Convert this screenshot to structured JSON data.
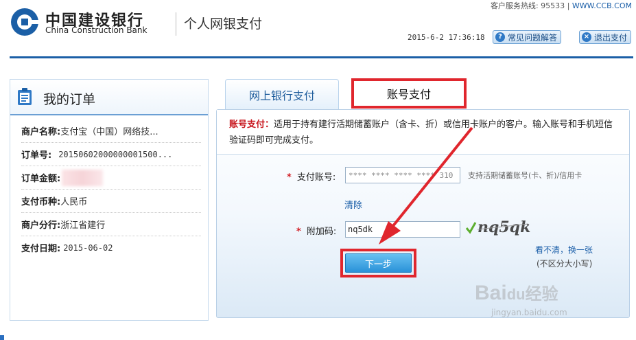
{
  "header": {
    "hotline": "客户服务热线: 95533",
    "url": "WWW.CCB.COM",
    "bank_name_cn": "中国建设银行",
    "bank_name_en": "China Construction Bank",
    "service_title": "个人网银支付",
    "datetime": "2015-6-2  17:36:18",
    "faq_button": "常见问题解答",
    "exit_button": "退出支付",
    "brand_color": "#1b5fa6"
  },
  "order": {
    "title": "我的订单",
    "rows": [
      {
        "key": "商户名称:",
        "value": "支付宝（中国）网络技..."
      },
      {
        "key": "订单号:",
        "value": "20150602000000001500..."
      },
      {
        "key": "订单金额:",
        "value": ""
      },
      {
        "key": "支付币种:",
        "value": "人民币"
      },
      {
        "key": "商户分行:",
        "value": "浙江省建行"
      },
      {
        "key": "支付日期:",
        "value": "2015-06-02"
      }
    ]
  },
  "tabs": {
    "online_banking": "网上银行支付",
    "account_payment": "账号支付"
  },
  "form": {
    "notice_label": "账号支付：",
    "notice_text": "适用于持有建行活期储蓄账户（含卡、折）或信用卡账户的客户。输入账号和手机短信验证码即可完成支付。",
    "account_label": "支付账号:",
    "account_value": "**** **** **** **** 310",
    "account_hint": "支持活期储蓄账号(卡、折)/信用卡",
    "clear_link": "清除",
    "code_label": "附加码:",
    "code_value": "nq5dk",
    "captcha_text": "nq5qk",
    "refresh_link": "看不清，换一张",
    "case_note": "(不区分大小写)",
    "next_button": "下一步"
  },
  "watermark": {
    "brand": "Bai",
    "brand2": "du",
    "suffix": "经验",
    "site": "jingyan.baidu.com"
  },
  "colors": {
    "highlight_red": "#e0262d",
    "button_blue": "#2a92d8"
  }
}
